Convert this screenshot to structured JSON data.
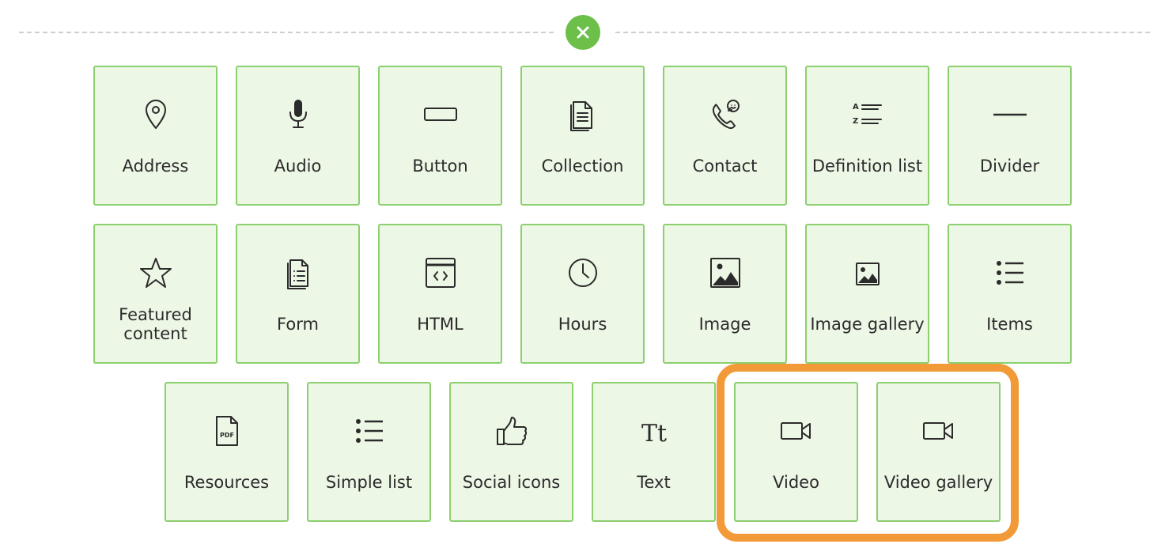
{
  "close_button": {
    "icon": "close-icon",
    "color": "#6cc04a"
  },
  "highlight_color": "#f29a38",
  "rows": [
    [
      {
        "label": "Address",
        "icon": "map-pin-icon"
      },
      {
        "label": "Audio",
        "icon": "microphone-icon"
      },
      {
        "label": "Button",
        "icon": "button-icon"
      },
      {
        "label": "Collection",
        "icon": "documents-icon"
      },
      {
        "label": "Contact",
        "icon": "phone-chat-icon"
      },
      {
        "label": "Definition list",
        "icon": "az-list-icon"
      },
      {
        "label": "Divider",
        "icon": "horizontal-rule-icon"
      }
    ],
    [
      {
        "label": "Featured content",
        "icon": "star-icon"
      },
      {
        "label": "Form",
        "icon": "form-document-icon"
      },
      {
        "label": "HTML",
        "icon": "code-window-icon"
      },
      {
        "label": "Hours",
        "icon": "clock-icon"
      },
      {
        "label": "Image",
        "icon": "image-icon"
      },
      {
        "label": "Image gallery",
        "icon": "image-gallery-icon"
      },
      {
        "label": "Items",
        "icon": "bullet-list-icon"
      }
    ],
    [
      {
        "label": "Resources",
        "icon": "pdf-file-icon",
        "icon_text": "PDF"
      },
      {
        "label": "Simple list",
        "icon": "bullet-list-icon"
      },
      {
        "label": "Social icons",
        "icon": "thumbs-up-icon"
      },
      {
        "label": "Text",
        "icon": "text-icon",
        "icon_text": "Tt"
      },
      {
        "label": "Video",
        "icon": "video-camera-icon"
      },
      {
        "label": "Video gallery",
        "icon": "video-camera-icon"
      }
    ]
  ]
}
